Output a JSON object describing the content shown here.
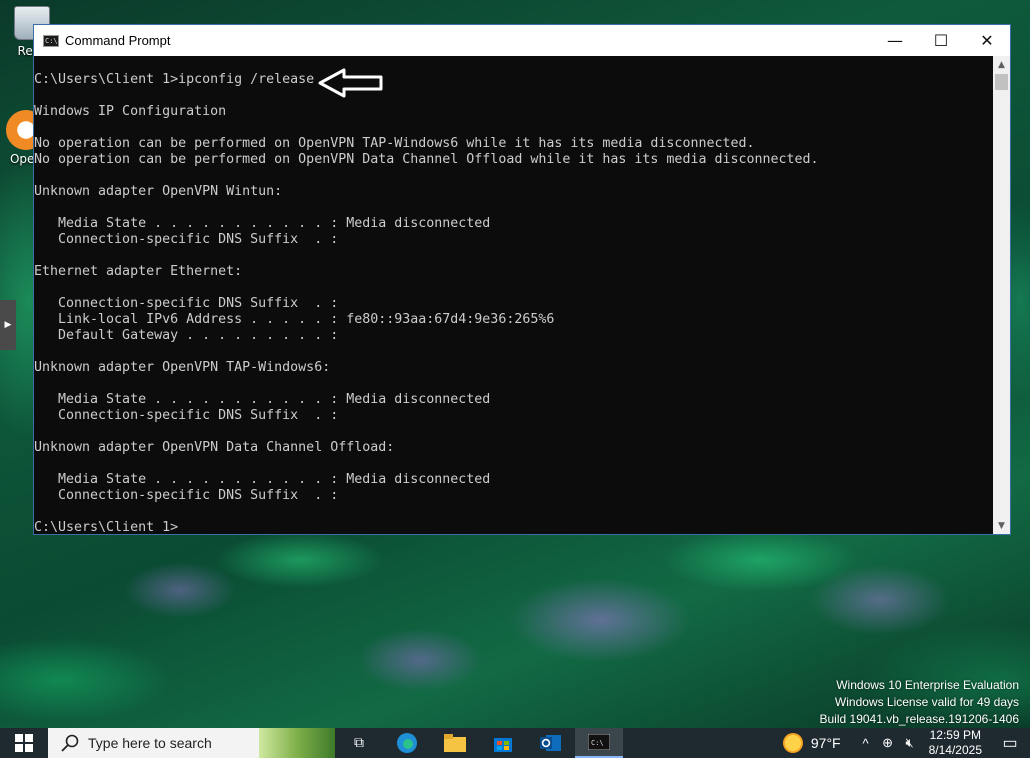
{
  "desktop": {
    "icons": [
      {
        "label": "Recy"
      },
      {
        "label": "Open"
      }
    ]
  },
  "window": {
    "title": "Command Prompt",
    "controls": {
      "minimize": "—",
      "maximize": "☐",
      "close": "✕"
    }
  },
  "console": {
    "lines": [
      "C:\\Users\\Client 1>ipconfig /release",
      "",
      "Windows IP Configuration",
      "",
      "No operation can be performed on OpenVPN TAP-Windows6 while it has its media disconnected.",
      "No operation can be performed on OpenVPN Data Channel Offload while it has its media disconnected.",
      "",
      "Unknown adapter OpenVPN Wintun:",
      "",
      "   Media State . . . . . . . . . . . : Media disconnected",
      "   Connection-specific DNS Suffix  . :",
      "",
      "Ethernet adapter Ethernet:",
      "",
      "   Connection-specific DNS Suffix  . :",
      "   Link-local IPv6 Address . . . . . : fe80::93aa:67d4:9e36:265%6",
      "   Default Gateway . . . . . . . . . :",
      "",
      "Unknown adapter OpenVPN TAP-Windows6:",
      "",
      "   Media State . . . . . . . . . . . : Media disconnected",
      "   Connection-specific DNS Suffix  . :",
      "",
      "Unknown adapter OpenVPN Data Channel Offload:",
      "",
      "   Media State . . . . . . . . . . . : Media disconnected",
      "   Connection-specific DNS Suffix  . :",
      "",
      "C:\\Users\\Client 1>"
    ]
  },
  "watermark": {
    "line1": "Windows 10 Enterprise Evaluation",
    "line2": "Windows License valid for 49 days",
    "line3": "Build 19041.vb_release.191206-1406"
  },
  "taskbar": {
    "search_placeholder": "Type here to search",
    "weather": "97°F",
    "time": "12:59 PM",
    "date": "8/14/2025"
  },
  "colors": {
    "console_bg": "#0c0c0c",
    "console_text": "#cccccc",
    "taskbar_bg": "#1f2a30"
  }
}
